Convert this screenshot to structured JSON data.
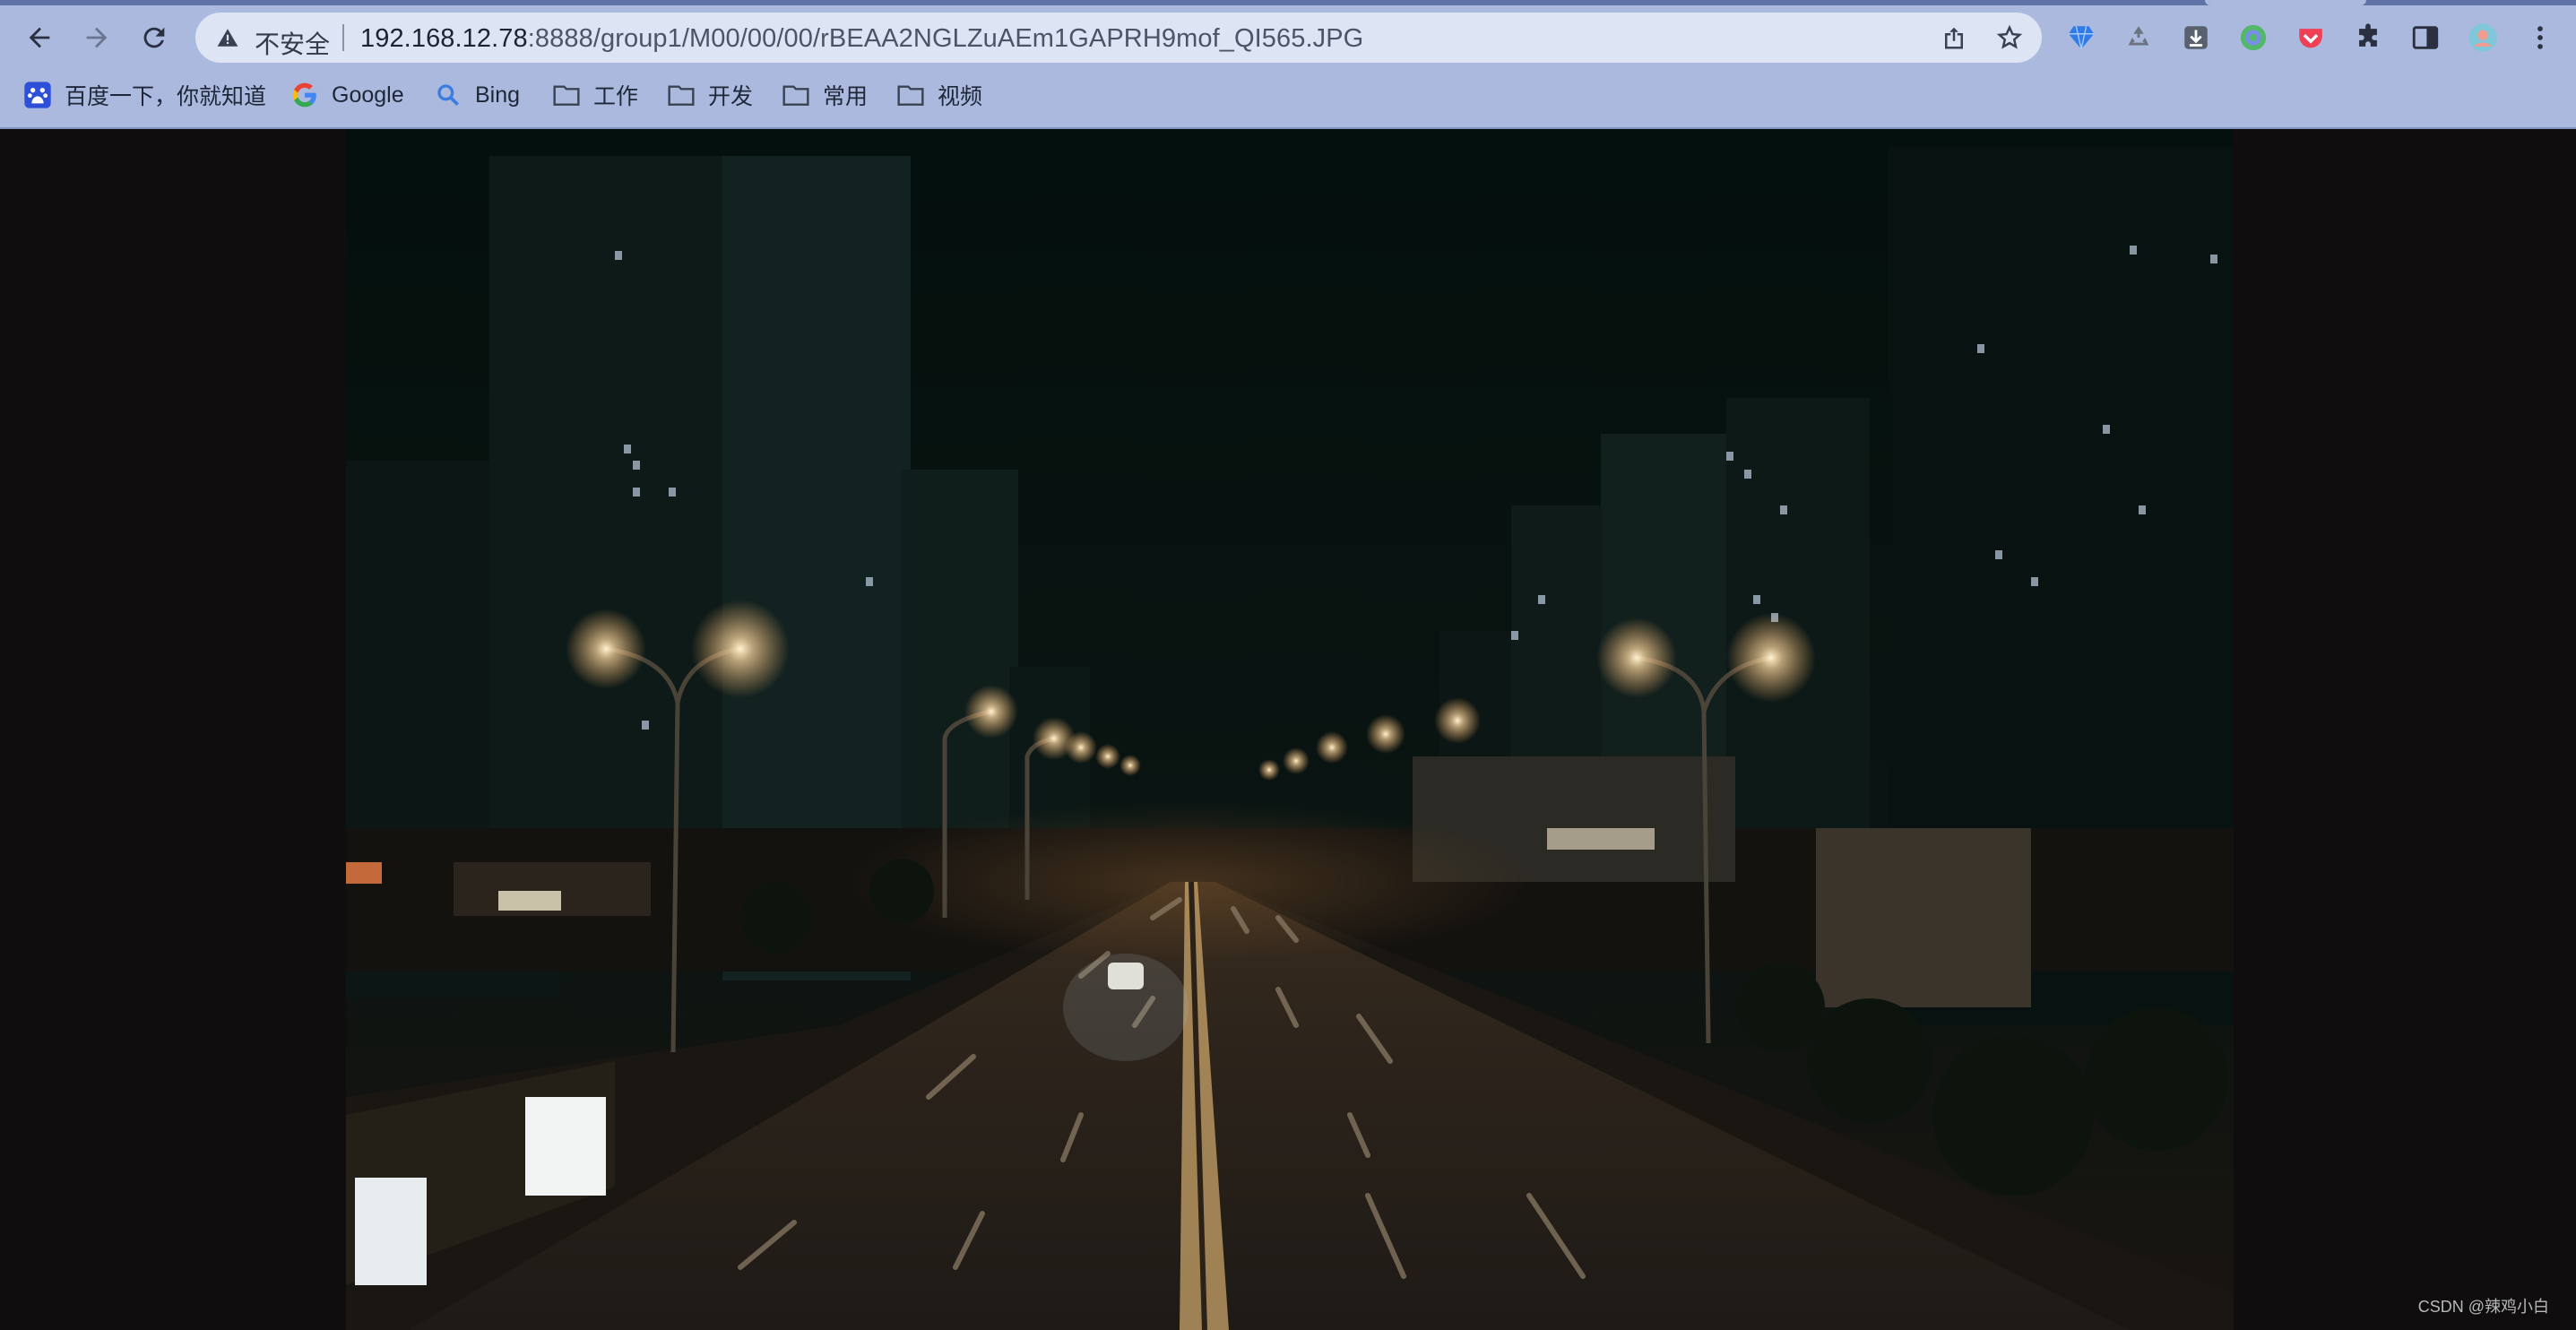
{
  "browser": {
    "security_label": "不安全",
    "url_host": "192.168.12.78",
    "url_path": ":8888/group1/M00/00/00/rBEAA2NGLZuAEm1GAPRH9mof_QI565.JPG",
    "icons": {
      "back": "arrow-left-icon",
      "forward": "arrow-right-icon",
      "reload": "reload-icon",
      "warning": "warning-triangle-icon",
      "share": "share-icon",
      "bookmark_star": "star-icon",
      "extensions": [
        "gem-extension-icon",
        "recycle-extension-icon",
        "download-extension-icon",
        "circle-extension-icon",
        "pocket-extension-icon",
        "puzzle-icon",
        "side-panel-icon",
        "profile-avatar-icon",
        "more-vertical-icon"
      ]
    }
  },
  "bookmarks": [
    {
      "label": "百度一下，你就知道",
      "icon": "baidu-icon"
    },
    {
      "label": "Google",
      "icon": "google-icon"
    },
    {
      "label": "Bing",
      "icon": "bing-search-icon"
    },
    {
      "label": "工作",
      "icon": "folder-icon"
    },
    {
      "label": "开发",
      "icon": "folder-icon"
    },
    {
      "label": "常用",
      "icon": "folder-icon"
    },
    {
      "label": "视频",
      "icon": "folder-icon"
    }
  ],
  "image": {
    "subject": "night city street with street lamps and high-rise buildings"
  },
  "watermark": "CSDN @辣鸡小白",
  "colors": {
    "chrome_bg": "#aab9dd",
    "omnibox_bg": "#dde4f4",
    "viewer_bg": "#0f0d0d",
    "lamp_glow": "#ffd9a0"
  }
}
